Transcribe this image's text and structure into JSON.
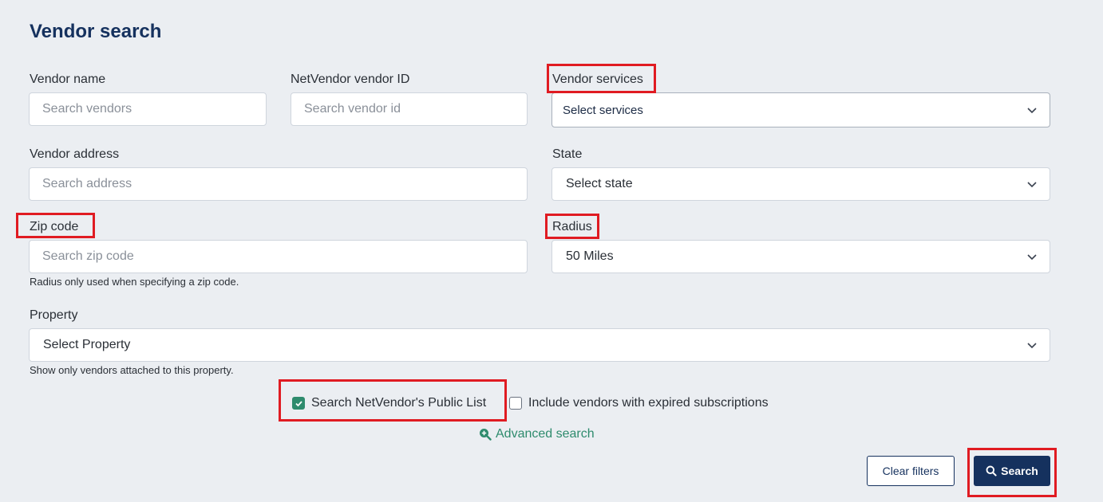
{
  "page": {
    "title": "Vendor search"
  },
  "fields": {
    "vendor_name": {
      "label": "Vendor name",
      "placeholder": "Search vendors"
    },
    "vendor_id": {
      "label": "NetVendor vendor ID",
      "placeholder": "Search vendor id"
    },
    "vendor_services": {
      "label": "Vendor services",
      "value": "Select services"
    },
    "vendor_address": {
      "label": "Vendor address",
      "placeholder": "Search address"
    },
    "state": {
      "label": "State",
      "value": "Select state"
    },
    "zip_code": {
      "label": "Zip code",
      "placeholder": "Search zip code",
      "hint": "Radius only used when specifying a zip code."
    },
    "radius": {
      "label": "Radius",
      "value": "50 Miles"
    },
    "property": {
      "label": "Property",
      "value": "Select Property",
      "hint": "Show only vendors attached to this property."
    }
  },
  "options": {
    "public_list": {
      "label": "Search NetVendor's Public List",
      "checked": true
    },
    "expired": {
      "label": "Include vendors with expired subscriptions",
      "checked": false
    }
  },
  "advanced_search": {
    "label": "Advanced search",
    "icon": "plus-magnifier-icon"
  },
  "actions": {
    "clear_label": "Clear filters",
    "search_label": "Search",
    "search_icon": "search-icon"
  },
  "colors": {
    "accent_navy": "#15315e",
    "accent_green": "#2e8b6d",
    "highlight_red": "#e01b22",
    "background": "#ebeef2"
  }
}
